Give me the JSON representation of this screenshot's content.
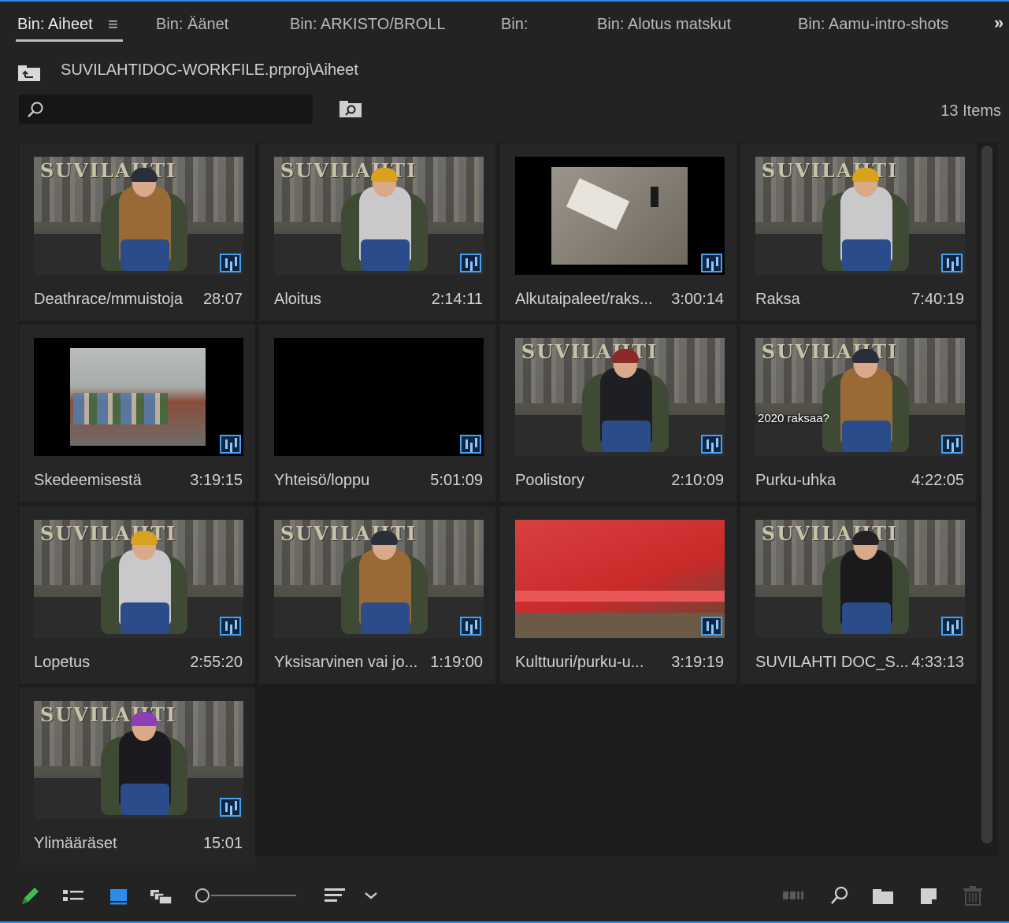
{
  "tabs": [
    {
      "label": "Bin: Aiheet",
      "active": true
    },
    {
      "label": "Bin: Äänet",
      "active": false
    },
    {
      "label": "Bin: ARKISTO/BROLL",
      "active": false
    },
    {
      "label": "Bin:",
      "active": false
    },
    {
      "label": "Bin: Alotus matskut",
      "active": false
    },
    {
      "label": "Bin: Aamu-intro-shots",
      "active": false
    }
  ],
  "tab_menu_glyph": "≡",
  "tab_overflow_glyph": "»",
  "path": "SUVILAHTIDOC-WORKFILE.prproj\\Aiheet",
  "search": {
    "placeholder": "",
    "value": ""
  },
  "items_count": "13 Items",
  "brand_text": "SUVILAHTI",
  "items": [
    {
      "name": "Deathrace/mmuistoja",
      "duration": "28:07",
      "thumb": "person-brown",
      "overlay": ""
    },
    {
      "name": "Aloitus",
      "duration": "2:14:11",
      "thumb": "person-grey-yellow",
      "overlay": ""
    },
    {
      "name": "Alkutaipaleet/raks...",
      "duration": "3:00:14",
      "thumb": "photo-skate-concrete",
      "overlay": ""
    },
    {
      "name": "Raksa",
      "duration": "7:40:19",
      "thumb": "person-grey-yellow",
      "overlay": ""
    },
    {
      "name": "Skedeemisestä",
      "duration": "3:19:15",
      "thumb": "photo-skatepark",
      "overlay": ""
    },
    {
      "name": "Yhteisö/loppu",
      "duration": "5:01:09",
      "thumb": "black",
      "overlay": ""
    },
    {
      "name": "Poolistory",
      "duration": "2:10:09",
      "thumb": "person-black-red",
      "overlay": ""
    },
    {
      "name": "Purku-uhka",
      "duration": "4:22:05",
      "thumb": "person-brown",
      "overlay": "2020 raksaa?"
    },
    {
      "name": "Lopetus",
      "duration": "2:55:20",
      "thumb": "person-grey-yellow",
      "overlay": ""
    },
    {
      "name": "Yksisarvinen vai jo...",
      "duration": "1:19:00",
      "thumb": "person-brown",
      "overlay": ""
    },
    {
      "name": "Kulttuuri/purku-u...",
      "duration": "3:19:19",
      "thumb": "photo-red-benches",
      "overlay": ""
    },
    {
      "name": "SUVILAHTI DOC_S...",
      "duration": "4:33:13",
      "thumb": "person-black-dark",
      "overlay": ""
    },
    {
      "name": "Ylimääräset",
      "duration": "15:01",
      "thumb": "person-purple",
      "overlay": ""
    }
  ],
  "colors": {
    "accent": "#2d8ceb",
    "badge": "#4aa0f0",
    "pencil": "#3fbf4f"
  },
  "toolbar_icons": [
    "pencil-icon",
    "list-view-icon",
    "icon-view-icon",
    "freeform-view-icon",
    "zoom-slider",
    "sort-icon",
    "chevron-down-icon",
    "automate-to-sequence-icon",
    "find-icon",
    "new-bin-icon",
    "new-item-icon",
    "trash-icon"
  ]
}
